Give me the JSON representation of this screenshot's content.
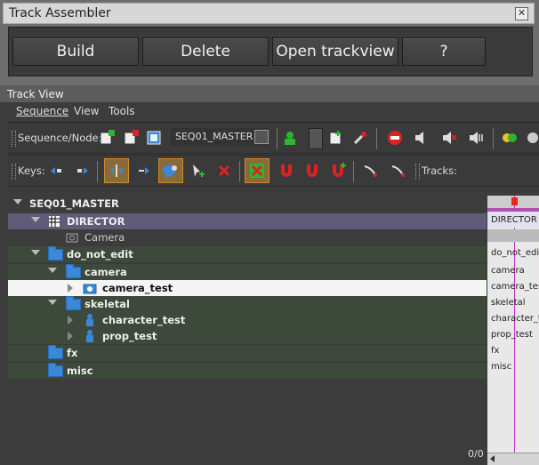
{
  "track_assembler": {
    "title": "Track Assembler",
    "buttons": {
      "build": "Build",
      "delete": "Delete",
      "open_trackview": "Open trackview",
      "help": "?"
    }
  },
  "track_view": {
    "title": "Track View",
    "menu": [
      "Sequence",
      "View",
      "Tools"
    ],
    "toolbar1": {
      "label": "Sequence/Node:",
      "sequence_value": "SEQ01_MASTER"
    },
    "toolbar2": {
      "keys_label": "Keys:",
      "tracks_label": "Tracks:"
    },
    "tree": [
      {
        "label": "SEQ01_MASTER",
        "level": 0,
        "kind": "root"
      },
      {
        "label": "DIRECTOR",
        "level": 1,
        "kind": "director"
      },
      {
        "label": "Camera",
        "level": 2,
        "kind": "camera-track"
      },
      {
        "label": "do_not_edit",
        "level": 1,
        "kind": "folder"
      },
      {
        "label": "camera",
        "level": 2,
        "kind": "folder"
      },
      {
        "label": "camera_test",
        "level": 3,
        "kind": "camera"
      },
      {
        "label": "skeletal",
        "level": 2,
        "kind": "folder"
      },
      {
        "label": "character_test",
        "level": 3,
        "kind": "entity"
      },
      {
        "label": "prop_test",
        "level": 3,
        "kind": "entity"
      },
      {
        "label": "fx",
        "level": 2,
        "kind": "folder"
      },
      {
        "label": "misc",
        "level": 2,
        "kind": "folder"
      }
    ],
    "right_labels": [
      "DIRECTOR",
      "do_not_edit",
      "camera",
      "camera_test",
      "skeletal",
      "character_test",
      "prop_test",
      "fx",
      "misc"
    ],
    "counter": "0/0"
  },
  "colors": {
    "director_row": "#5f5c78",
    "folder_row": "#3d4a3b",
    "selected_row": "#f5f5f5",
    "folder_blue": "#3a88d8",
    "timeline_marker": "#c030c0"
  },
  "icons": [
    "close-icon",
    "folder-icon",
    "camera-icon",
    "entity-icon",
    "director-icon"
  ]
}
